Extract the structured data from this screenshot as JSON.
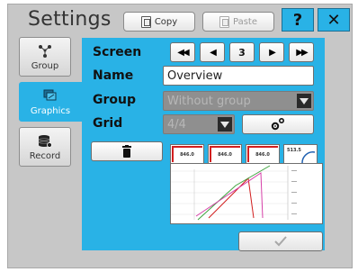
{
  "header": {
    "title": "Settings",
    "copy_label": "Copy",
    "paste_label": "Paste",
    "help_label": "?",
    "close_label": "✕"
  },
  "nav": {
    "items": [
      {
        "label": "Group",
        "icon": "group-icon",
        "active": false
      },
      {
        "label": "Graphics",
        "icon": "graphics-icon",
        "active": true
      },
      {
        "label": "Record",
        "icon": "record-icon",
        "active": false
      }
    ]
  },
  "screen": {
    "label": "Screen",
    "number": "3"
  },
  "name": {
    "label": "Name",
    "value": "Overview"
  },
  "group": {
    "label": "Group",
    "value": "Without group"
  },
  "grid": {
    "label": "Grid",
    "value": "4/4"
  },
  "thumbnails": [
    {
      "value": "846.0"
    },
    {
      "value": "846.0"
    },
    {
      "value": "846.0"
    },
    {
      "value": "513.5"
    }
  ],
  "colors": {
    "accent": "#29b2e6",
    "background": "#c7c7c7",
    "trend_red": "#d21f1f",
    "trend_green": "#3da33d",
    "trend_magenta": "#d63fa8"
  }
}
